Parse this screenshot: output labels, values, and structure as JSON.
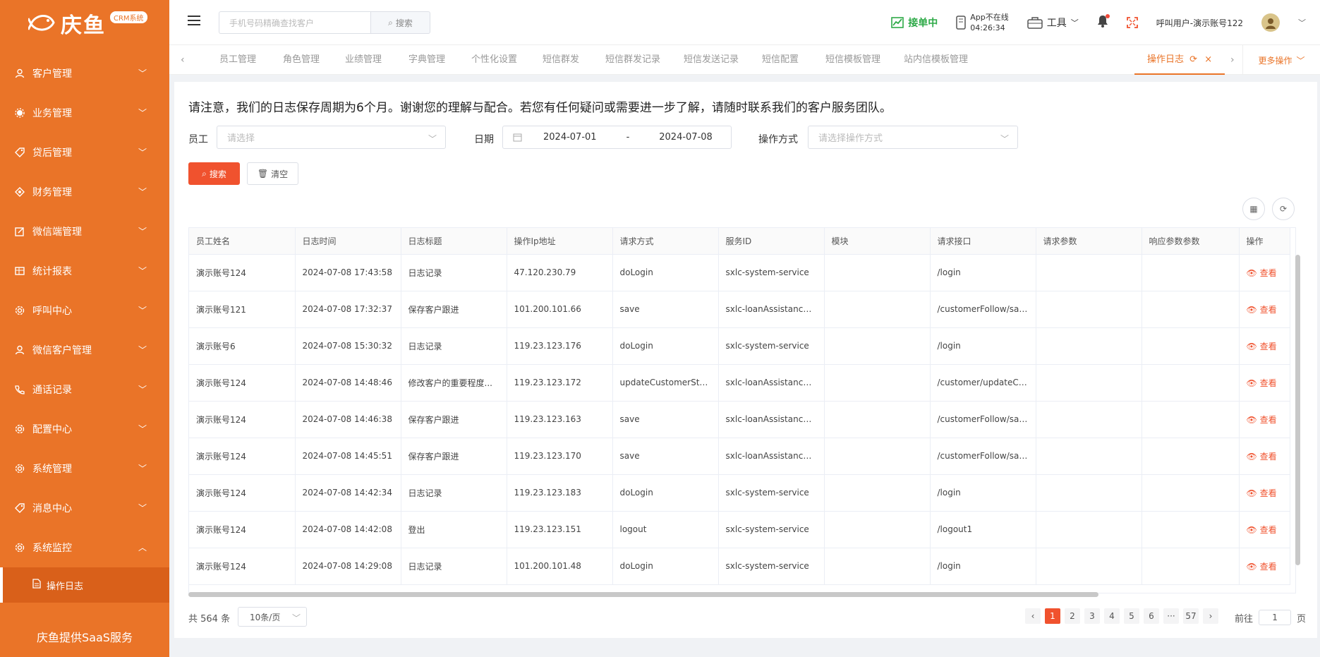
{
  "brand": {
    "name": "庆鱼",
    "badge": "CRM系统",
    "footer": "庆鱼提供SaaS服务"
  },
  "sidebar": {
    "items": [
      {
        "label": "客户管理",
        "icon": "user-icon"
      },
      {
        "label": "业务管理",
        "icon": "gear-flower-icon"
      },
      {
        "label": "贷后管理",
        "icon": "tag-icon"
      },
      {
        "label": "财务管理",
        "icon": "money-icon"
      },
      {
        "label": "微信端管理",
        "icon": "edit-icon"
      },
      {
        "label": "统计报表",
        "icon": "table-icon"
      },
      {
        "label": "呼叫中心",
        "icon": "settings-icon"
      },
      {
        "label": "微信客户管理",
        "icon": "user-icon"
      },
      {
        "label": "通话记录",
        "icon": "phone-icon"
      },
      {
        "label": "配置中心",
        "icon": "settings-icon"
      },
      {
        "label": "系统管理",
        "icon": "settings-icon"
      },
      {
        "label": "消息中心",
        "icon": "tag-icon"
      },
      {
        "label": "系统监控",
        "icon": "settings-icon"
      }
    ],
    "active_sub": "操作日志"
  },
  "header": {
    "search_placeholder": "手机号码精确查找客户",
    "search_button": "搜索",
    "order_status": "接单中",
    "app_status": "App不在线",
    "app_timer": "04:26:34",
    "tools": "工具",
    "user": "呼叫用户-演示账号122"
  },
  "tabs": {
    "items": [
      "员工管理",
      "角色管理",
      "业绩管理",
      "字典管理",
      "个性化设置",
      "短信群发",
      "短信群发记录",
      "短信发送记录",
      "短信配置",
      "短信模板管理",
      "站内信模板管理"
    ],
    "active": "操作日志",
    "more": "更多操作"
  },
  "notice": "请注意，我们的日志保存周期为6个月。谢谢您的理解与配合。若您有任何疑问或需要进一步了解，请随时联系我们的客户服务团队。",
  "filters": {
    "employee_label": "员工",
    "employee_placeholder": "请选择",
    "date_label": "日期",
    "date_start": "2024-07-01",
    "date_sep": "-",
    "date_end": "2024-07-08",
    "method_label": "操作方式",
    "method_placeholder": "请选择操作方式",
    "search_button": "搜索",
    "clear_button": "清空"
  },
  "table": {
    "columns": [
      "员工姓名",
      "日志时间",
      "日志标题",
      "操作Ip地址",
      "请求方式",
      "服务ID",
      "模块",
      "请求接口",
      "请求参数",
      "响应参数参数",
      "操作"
    ],
    "action_label": "查看",
    "rows": [
      [
        "演示账号124",
        "2024-07-08 17:43:58",
        "日志记录",
        "47.120.230.79",
        "doLogin",
        "sxlc-system-service",
        "",
        "/login",
        "",
        ""
      ],
      [
        "演示账号121",
        "2024-07-08 17:32:37",
        "保存客户跟进",
        "101.200.101.66",
        "save",
        "sxlc-loanAssistance-s...",
        "",
        "/customerFollow/save",
        "",
        ""
      ],
      [
        "演示账号6",
        "2024-07-08 15:30:32",
        "日志记录",
        "119.23.123.176",
        "doLogin",
        "sxlc-system-service",
        "",
        "/login",
        "",
        ""
      ],
      [
        "演示账号124",
        "2024-07-08 14:48:46",
        "修改客户的重要程度...",
        "119.23.123.172",
        "updateCustomerStatus",
        "sxlc-loanAssistance-s...",
        "",
        "/customer/updateCus...",
        "",
        ""
      ],
      [
        "演示账号124",
        "2024-07-08 14:46:38",
        "保存客户跟进",
        "119.23.123.163",
        "save",
        "sxlc-loanAssistance-s...",
        "",
        "/customerFollow/save",
        "",
        ""
      ],
      [
        "演示账号124",
        "2024-07-08 14:45:51",
        "保存客户跟进",
        "119.23.123.170",
        "save",
        "sxlc-loanAssistance-s...",
        "",
        "/customerFollow/save",
        "",
        ""
      ],
      [
        "演示账号124",
        "2024-07-08 14:42:34",
        "日志记录",
        "119.23.123.183",
        "doLogin",
        "sxlc-system-service",
        "",
        "/login",
        "",
        ""
      ],
      [
        "演示账号124",
        "2024-07-08 14:42:08",
        "登出",
        "119.23.123.151",
        "logout",
        "sxlc-system-service",
        "",
        "/logout1",
        "",
        ""
      ],
      [
        "演示账号124",
        "2024-07-08 14:29:08",
        "日志记录",
        "101.200.101.48",
        "doLogin",
        "sxlc-system-service",
        "",
        "/login",
        "",
        ""
      ]
    ]
  },
  "pagination": {
    "total": "共 564 条",
    "page_size": "10条/页",
    "pages": [
      "1",
      "2",
      "3",
      "4",
      "5",
      "6",
      "···",
      "57"
    ],
    "goto_prefix": "前往",
    "goto_value": "1",
    "goto_suffix": "页"
  },
  "colors": {
    "accent": "#ea7428",
    "danger": "#f0522e",
    "online": "#2eaa48"
  }
}
